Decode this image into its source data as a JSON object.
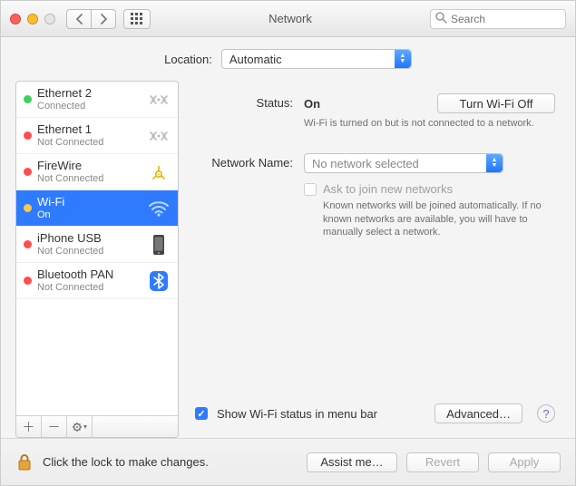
{
  "window": {
    "title": "Network"
  },
  "search": {
    "placeholder": "Search"
  },
  "location": {
    "label": "Location:",
    "selected": "Automatic"
  },
  "services": [
    {
      "name": "Ethernet 2",
      "status": "Connected",
      "dot": "green",
      "icon": "arrows"
    },
    {
      "name": "Ethernet 1",
      "status": "Not Connected",
      "dot": "red",
      "icon": "arrows"
    },
    {
      "name": "FireWire",
      "status": "Not Connected",
      "dot": "red",
      "icon": "firewire"
    },
    {
      "name": "Wi-Fi",
      "status": "On",
      "dot": "orange",
      "icon": "wifi"
    },
    {
      "name": "iPhone USB",
      "status": "Not Connected",
      "dot": "red",
      "icon": "phone"
    },
    {
      "name": "Bluetooth PAN",
      "status": "Not Connected",
      "dot": "red",
      "icon": "bluetooth"
    }
  ],
  "detail": {
    "status_label": "Status:",
    "status_value": "On",
    "wifi_toggle_btn": "Turn Wi-Fi Off",
    "status_sub": "Wi-Fi is turned on but is not connected to a network.",
    "netname_label": "Network Name:",
    "netname_selected": "No network selected",
    "ask_label": "Ask to join new networks",
    "ask_sub": "Known networks will be joined automatically. If no known networks are available, you will have to manually select a network.",
    "show_status_label": "Show Wi-Fi status in menu bar",
    "advanced_btn": "Advanced…"
  },
  "footer": {
    "lock_text": "Click the lock to make changes.",
    "assist_btn": "Assist me…",
    "revert_btn": "Revert",
    "apply_btn": "Apply"
  }
}
